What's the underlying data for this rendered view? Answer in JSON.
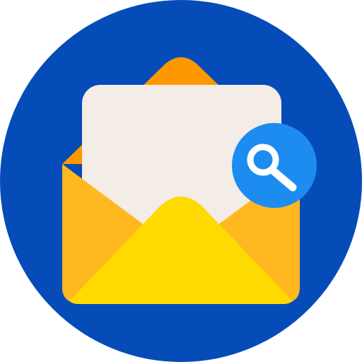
{
  "icon": {
    "name": "open-envelope-search-icon",
    "colors": {
      "background_circle": "#054CB8",
      "envelope_back_flap": "#FE9800",
      "envelope_body": "#FFB820",
      "envelope_front": "#FFDA00",
      "letter_paper": "#F4ECE6",
      "search_badge": "#1C8CF0",
      "search_glyph": "#FFFFFF"
    }
  }
}
